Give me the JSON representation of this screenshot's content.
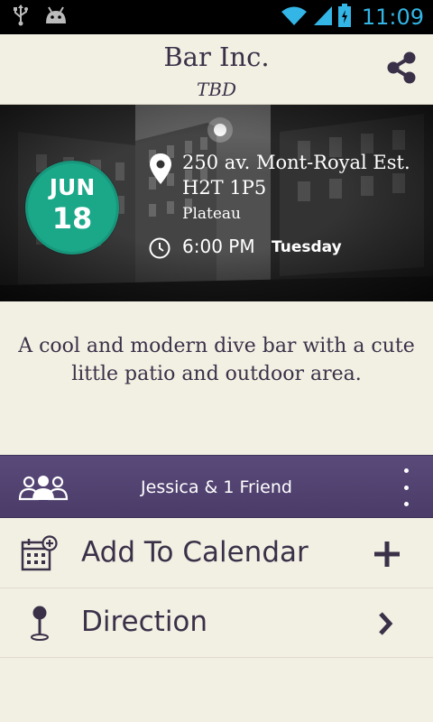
{
  "status_bar": {
    "time": "11:09",
    "icons": [
      "usb-icon",
      "android-icon",
      "wifi-icon",
      "signal-icon",
      "battery-charging-icon"
    ],
    "clock_color": "#33b5e5"
  },
  "header": {
    "title": "Bar Inc.",
    "subtitle": "TBD",
    "share_icon": "share-icon"
  },
  "event": {
    "date": {
      "month": "JUN",
      "day": "18"
    },
    "address_line1": "250 av. Mont-Royal Est.",
    "address_line2": "H2T 1P5",
    "neighborhood": "Plateau",
    "time": "6:00 PM",
    "weekday": "Tuesday",
    "description": "A cool and modern dive bar with a cute little patio and outdoor area."
  },
  "attendees": {
    "label": "Jessica & 1 Friend",
    "icon": "people-icon",
    "menu_icon": "more-vert-icon"
  },
  "actions": [
    {
      "label": "Add To Calendar",
      "icon": "calendar-add-icon",
      "action_icon": "plus-icon"
    },
    {
      "label": "Direction",
      "icon": "map-pin-icon",
      "action_icon": "chevron-right-icon"
    }
  ],
  "colors": {
    "accent_green": "#1aa889",
    "purple_bar": "#4e3f6e",
    "text_dark": "#3a3148",
    "background": "#f2efe3"
  }
}
